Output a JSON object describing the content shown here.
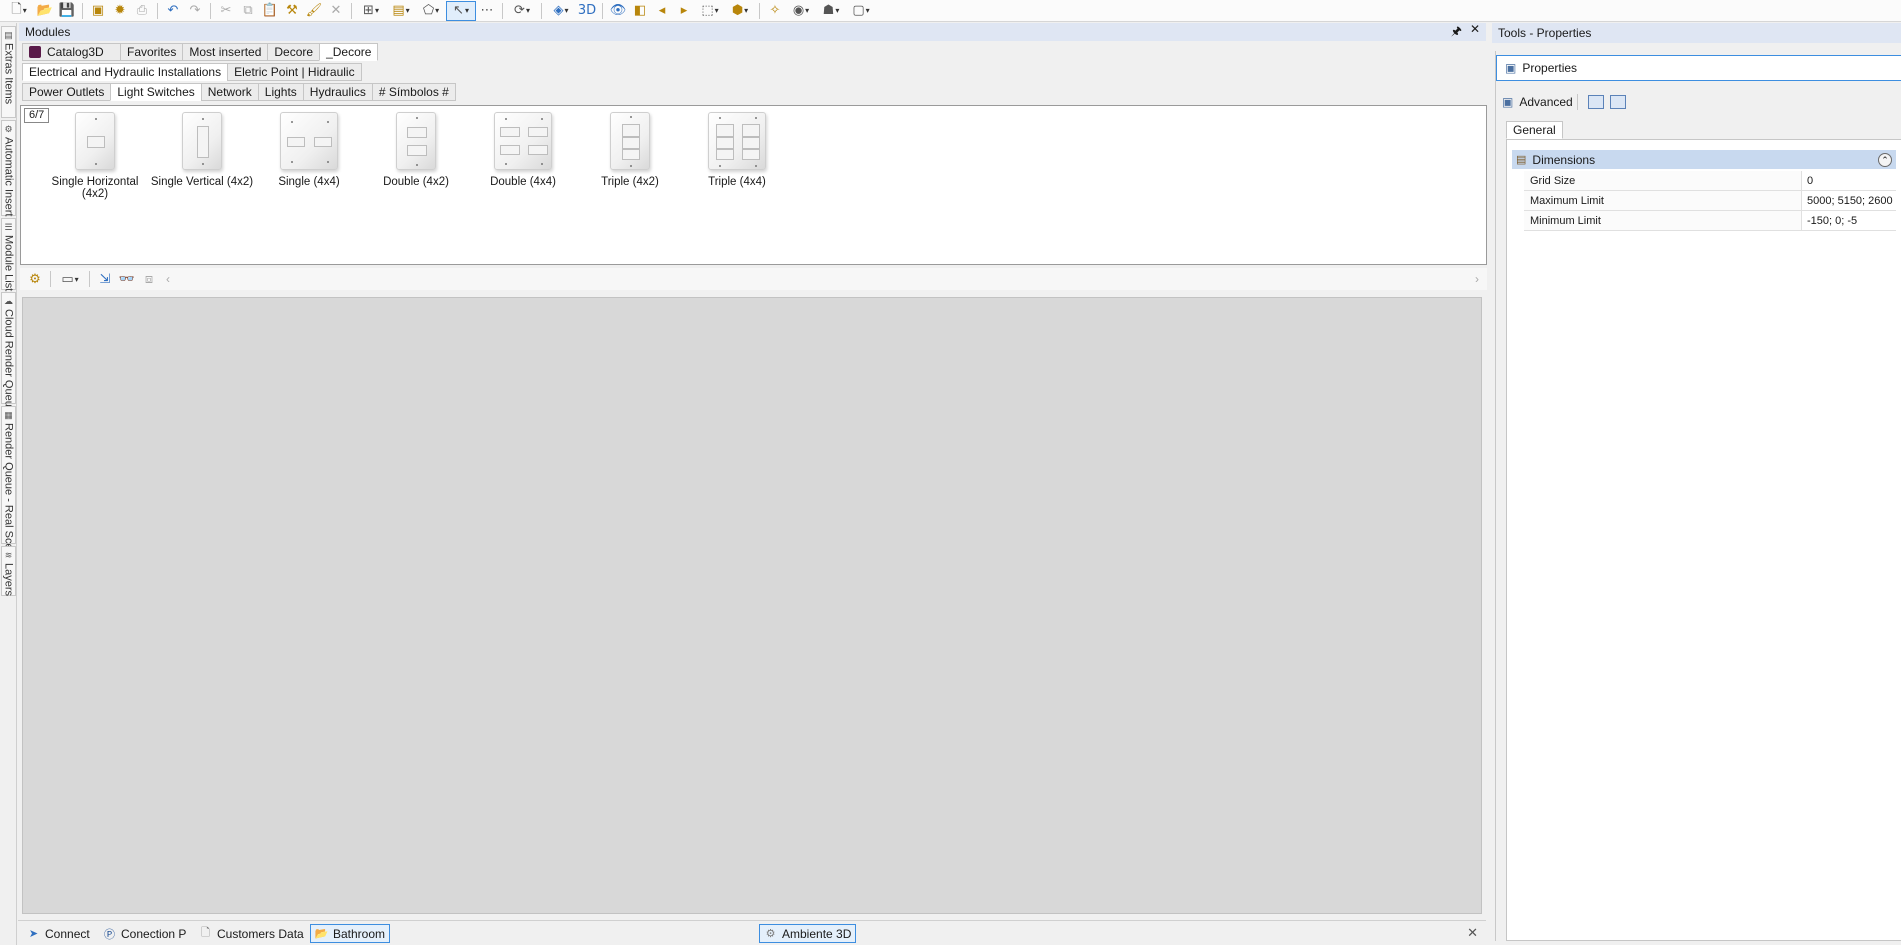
{
  "modules_panel": {
    "title": "Modules",
    "pin_glyph": "🖈",
    "close_glyph": "✕",
    "top_tabs": [
      {
        "label": "Catalog3D",
        "icon": "catalog3d-icon"
      },
      {
        "label": "Favorites"
      },
      {
        "label": "Most inserted"
      },
      {
        "label": "Decore"
      },
      {
        "label": "_Decore"
      }
    ],
    "second_tabs": [
      "Electrical and Hydraulic Installations",
      "Eletric Point | Hidraulic"
    ],
    "category_tabs": [
      "Power Outlets",
      "Light Switches",
      "Network",
      "Lights",
      "Hydraulics",
      "# Símbolos #"
    ],
    "active_category": "Light Switches",
    "page_counter": "6/7",
    "items": [
      {
        "label": "Single Horizontal (4x2)",
        "plate": "4x2",
        "rockers": "single-horizontal"
      },
      {
        "label": "Single Vertical (4x2)",
        "plate": "4x2",
        "rockers": "single-vertical"
      },
      {
        "label": "Single (4x4)",
        "plate": "4x4",
        "rockers": "single-4x4"
      },
      {
        "label": "Double (4x2)",
        "plate": "4x2",
        "rockers": "double-4x2"
      },
      {
        "label": "Double (4x4)",
        "plate": "4x4",
        "rockers": "double-4x4"
      },
      {
        "label": "Triple (4x2)",
        "plate": "4x2",
        "rockers": "triple-4x2"
      },
      {
        "label": "Triple (4x4)",
        "plate": "4x4",
        "rockers": "triple-4x4"
      }
    ]
  },
  "side_tabs": [
    {
      "label": "Extras Items",
      "icon": "extras-icon"
    },
    {
      "label": "Automatic Insert",
      "icon": "automatic-insert-icon"
    },
    {
      "label": "Module List",
      "icon": "module-list-icon"
    },
    {
      "label": "Cloud Render Queue",
      "icon": "cloud-render-icon"
    },
    {
      "label": "Render Queue - Real Scene",
      "icon": "render-queue-icon"
    },
    {
      "label": "Layers",
      "icon": "layers-icon"
    }
  ],
  "bottom_tabs": [
    {
      "label": "Connect",
      "icon": "connect-icon"
    },
    {
      "label": "Conection P",
      "icon": "connection-p-icon"
    },
    {
      "label": "Customers Data",
      "icon": "document-icon"
    },
    {
      "label": "Bathroom",
      "icon": "folder-icon",
      "active": true
    },
    {
      "label": "Ambiente 3D",
      "icon": "ambiente-3d-icon",
      "active": true
    }
  ],
  "properties_panel": {
    "title": "Tools - Properties",
    "header": "Properties",
    "mode": "Advanced",
    "tab": "General",
    "category": "Dimensions",
    "rows": [
      {
        "name": "Grid Size",
        "value": "0"
      },
      {
        "name": "Maximum Limit",
        "value": "5000; 5150; 2600"
      },
      {
        "name": "Minimum Limit",
        "value": "-150; 0; -5"
      }
    ]
  },
  "colors": {
    "accent": "#3d8ee0",
    "panel_header": "#dfe6f3",
    "viewport": "#d8d8d8",
    "category_row": "#c8d9ef",
    "catalog_icon": "#5a1a49"
  }
}
